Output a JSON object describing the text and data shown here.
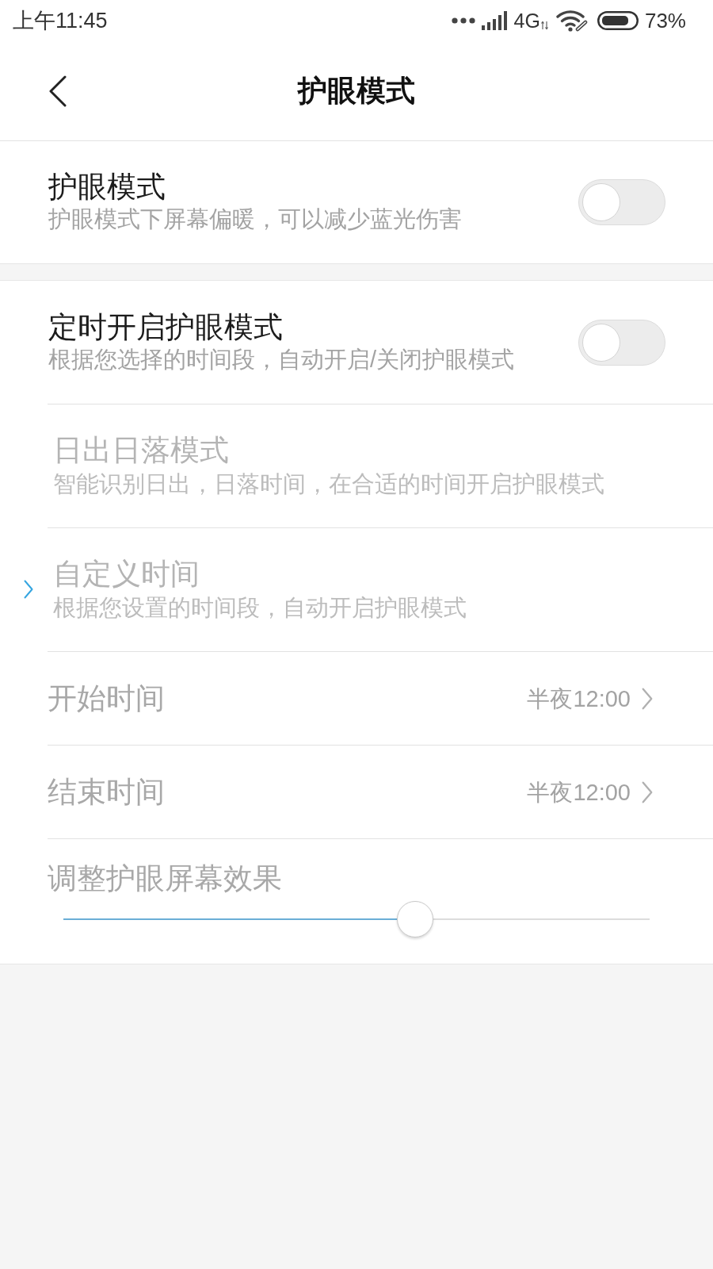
{
  "status_bar": {
    "time": "上午11:45",
    "network": "4G",
    "battery": "73%"
  },
  "header": {
    "title": "护眼模式"
  },
  "eye_care": {
    "title": "护眼模式",
    "subtitle": "护眼模式下屏幕偏暖，可以减少蓝光伤害",
    "on": false
  },
  "schedule": {
    "title": "定时开启护眼模式",
    "subtitle": "根据您选择的时间段，自动开启/关闭护眼模式",
    "on": false
  },
  "schedule_options": [
    {
      "title": "日出日落模式",
      "subtitle": "智能识别日出，日落时间，在合适的时间开启护眼模式",
      "selected": false
    },
    {
      "title": "自定义时间",
      "subtitle": "根据您设置的时间段，自动开启护眼模式",
      "selected": true
    }
  ],
  "times": [
    {
      "label": "开始时间",
      "value": "半夜12:00"
    },
    {
      "label": "结束时间",
      "value": "半夜12:00"
    }
  ],
  "effect": {
    "label": "调整护眼屏幕效果",
    "level": 0.6
  }
}
